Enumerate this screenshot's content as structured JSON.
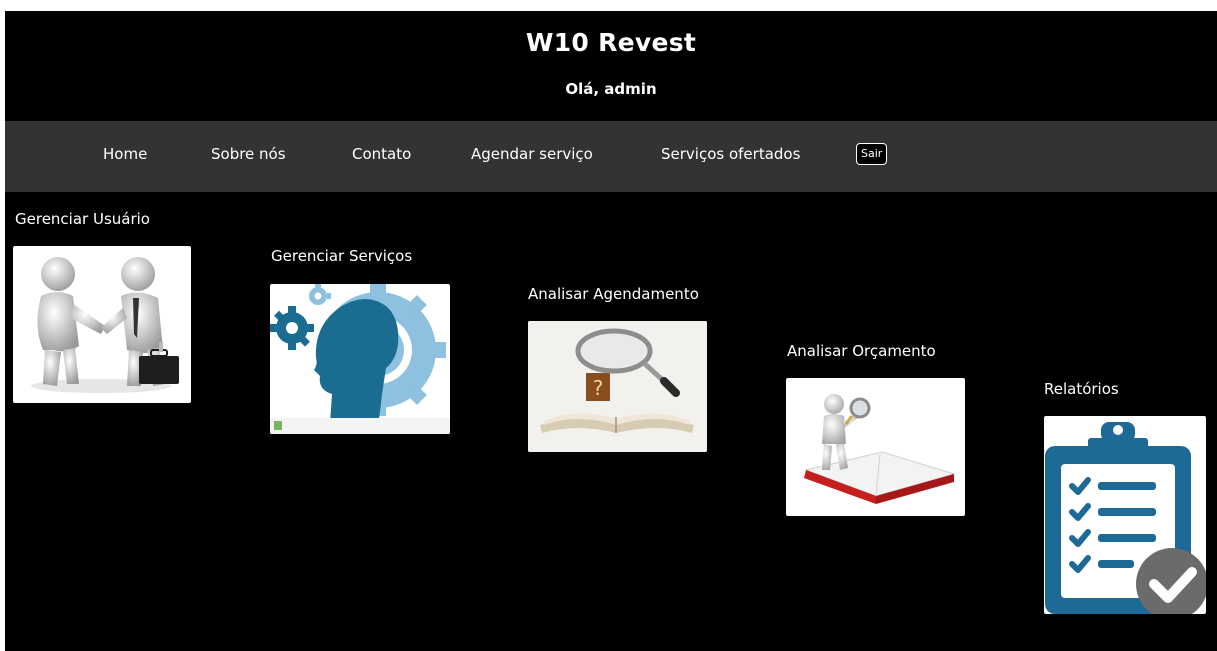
{
  "header": {
    "title": "W10 Revest",
    "greeting": "Olá, admin"
  },
  "nav": {
    "items": [
      "Home",
      "Sobre nós",
      "Contato",
      "Agendar serviço",
      "Serviços ofertados"
    ],
    "logout_label": "Sair"
  },
  "cards": [
    {
      "title": "Gerenciar Usuário",
      "icon": "handshake-icon"
    },
    {
      "title": "Gerenciar Serviços",
      "icon": "gears-head-icon"
    },
    {
      "title": "Analisar Agendamento",
      "icon": "magnifier-book-icon"
    },
    {
      "title": "Analisar Orçamento",
      "icon": "figure-magnifier-book-icon"
    },
    {
      "title": "Relatórios",
      "icon": "clipboard-check-icon"
    }
  ],
  "colors": {
    "background": "#000000",
    "navbar": "#333333",
    "text": "#ffffff",
    "report_blue": "#1d6a97"
  }
}
